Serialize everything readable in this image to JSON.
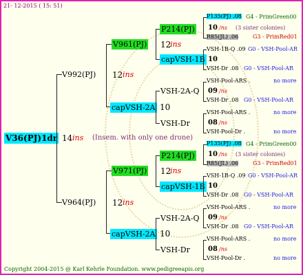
{
  "date": "21- 12-2015 ( 15: 51)",
  "footer": "Copyright 2004-2015 @ Karl Kehrle Foundation.   www.pedigreeapis.org",
  "root": {
    "name": "V36(PJ)1dr",
    "ins": "14",
    "ins_label": "ins",
    "note": "(Insem. with only one drone)"
  },
  "top": {
    "name": "V992(PJ)",
    "ins": "12",
    "ins_label": "ins",
    "a": {
      "name": "V961(PJ)",
      "ins": "12",
      "ins_label": "ins",
      "a": {
        "name": "P214(PJ)",
        "a": {
          "name": "P135(PJ) .08",
          "suffix": "G4 - PrimGreen00"
        },
        "num": "10",
        "ins_label": "/ns",
        "note": "(3 sister colonies)",
        "b": {
          "name": "R85(JL) .06",
          "suffix": "G3 - PrimRed01"
        }
      },
      "b": {
        "name": "capVSH-1B",
        "a": {
          "name": "VSH-1B-Q .09",
          "suffix": "G0 - VSH-Pool-AR"
        },
        "num": "10",
        "b": {
          "name": "VSH-Dr .08",
          "suffix": "G0 - VSH-Pool-AR"
        }
      }
    },
    "b": {
      "name": "capVSH-2A",
      "num": "10",
      "a": {
        "name": "VSH-2A-Q",
        "a": {
          "name": "VSH-Pool-ARS .",
          "more": "no more"
        },
        "num": "09",
        "ins_label": "/ns",
        "b": {
          "name": "VSH-Dr .08",
          "suffix": "G0 - VSH-Pool-AR"
        }
      },
      "b": {
        "name": "VSH-Dr",
        "a": {
          "name": "VSH-Pool-ARS .",
          "more": "no more"
        },
        "num": "08",
        "ins_label": "/ns",
        "b": {
          "name": "VSH-Pool-Dr .",
          "more": "no more"
        }
      }
    }
  },
  "bottom": {
    "name": "V964(PJ)",
    "ins": "12",
    "ins_label": "ins",
    "a": {
      "name": "V971(PJ)",
      "ins": "12",
      "ins_label": "ins",
      "a": {
        "name": "P214(PJ)",
        "a": {
          "name": "P135(PJ) .08",
          "suffix": "G4 - PrimGreen00"
        },
        "num": "10",
        "ins_label": "/ns",
        "note": "(3 sister colonies)",
        "b": {
          "name": "R85(JL) .06",
          "suffix": "G3 - PrimRed01"
        }
      },
      "b": {
        "name": "capVSH-1B",
        "a": {
          "name": "VSH-1B-Q .09",
          "suffix": "G0 - VSH-Pool-AR"
        },
        "num": "10",
        "b": {
          "name": "VSH-Dr .08",
          "suffix": "G0 - VSH-Pool-AR"
        }
      }
    },
    "b": {
      "name": "capVSH-2A",
      "num": "10",
      "a": {
        "name": "VSH-2A-Q",
        "a": {
          "name": "VSH-Pool-ARS .",
          "more": "no more"
        },
        "num": "09",
        "ins_label": "/ns",
        "b": {
          "name": "VSH-Dr .08",
          "suffix": "G0 - VSH-Pool-AR"
        }
      },
      "b": {
        "name": "VSH-Dr",
        "a": {
          "name": "VSH-Pool-ARS .",
          "more": "no more"
        },
        "num": "08",
        "ins_label": "/ns",
        "b": {
          "name": "VSH-Pool-Dr .",
          "more": "no more"
        }
      }
    }
  }
}
